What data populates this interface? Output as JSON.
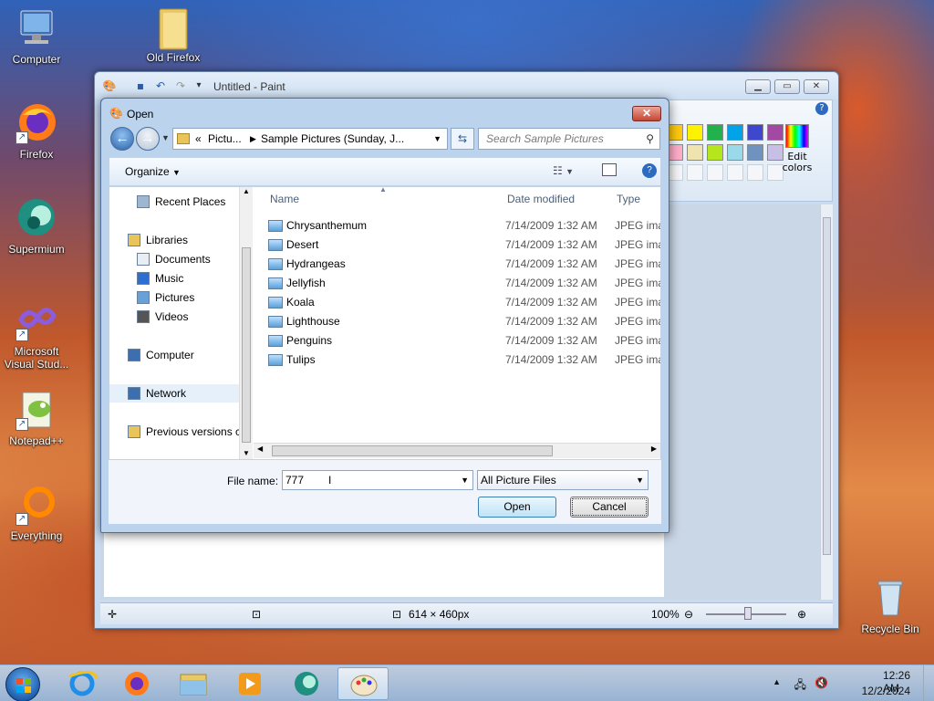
{
  "desktop": {
    "icons": [
      {
        "label": "Computer"
      },
      {
        "label": "Old Firefox"
      },
      {
        "label": "Firefox"
      },
      {
        "label": "Supermium"
      },
      {
        "label": "Microsoft Visual Stud..."
      },
      {
        "label": "Notepad++"
      },
      {
        "label": "Everything"
      },
      {
        "label": "Recycle Bin"
      }
    ]
  },
  "paint": {
    "title": "Untitled - Paint",
    "edit_colors": "Edit colors",
    "colors": [
      "#ffc90e",
      "#fff200",
      "#22b14c",
      "#00a2e8",
      "#3f48cc",
      "#a349a4",
      "#ffaec9",
      "#efe4b0",
      "#b5e61d",
      "#99d9ea",
      "#7092be",
      "#c8bfe7"
    ],
    "status": {
      "size": "614 × 460px",
      "zoom": "100%"
    }
  },
  "dialog": {
    "title": "Open",
    "breadcrumb_prefix": "«",
    "breadcrumb_1": "Pictu...",
    "breadcrumb_2": "Sample Pictures (Sunday, J...",
    "search_placeholder": "Search Sample Pictures",
    "organize": "Organize",
    "nav": [
      {
        "label": "Recent Places"
      },
      {
        "label": "Libraries"
      },
      {
        "label": "Documents"
      },
      {
        "label": "Music"
      },
      {
        "label": "Pictures"
      },
      {
        "label": "Videos"
      },
      {
        "label": "Computer"
      },
      {
        "label": "Network"
      },
      {
        "label": "Previous versions c"
      }
    ],
    "columns": {
      "name": "Name",
      "date": "Date modified",
      "type": "Type"
    },
    "files": [
      {
        "name": "Chrysanthemum",
        "date": "7/14/2009 1:32 AM",
        "type": "JPEG image"
      },
      {
        "name": "Desert",
        "date": "7/14/2009 1:32 AM",
        "type": "JPEG image"
      },
      {
        "name": "Hydrangeas",
        "date": "7/14/2009 1:32 AM",
        "type": "JPEG image"
      },
      {
        "name": "Jellyfish",
        "date": "7/14/2009 1:32 AM",
        "type": "JPEG image"
      },
      {
        "name": "Koala",
        "date": "7/14/2009 1:32 AM",
        "type": "JPEG image"
      },
      {
        "name": "Lighthouse",
        "date": "7/14/2009 1:32 AM",
        "type": "JPEG image"
      },
      {
        "name": "Penguins",
        "date": "7/14/2009 1:32 AM",
        "type": "JPEG image"
      },
      {
        "name": "Tulips",
        "date": "7/14/2009 1:32 AM",
        "type": "JPEG image"
      }
    ],
    "file_name_label": "File name:",
    "file_name_value": "777",
    "file_type": "All Picture Files",
    "open_label": "Open",
    "cancel_label": "Cancel"
  },
  "taskbar": {
    "time": "12:26 AM",
    "date": "12/2/2024"
  }
}
